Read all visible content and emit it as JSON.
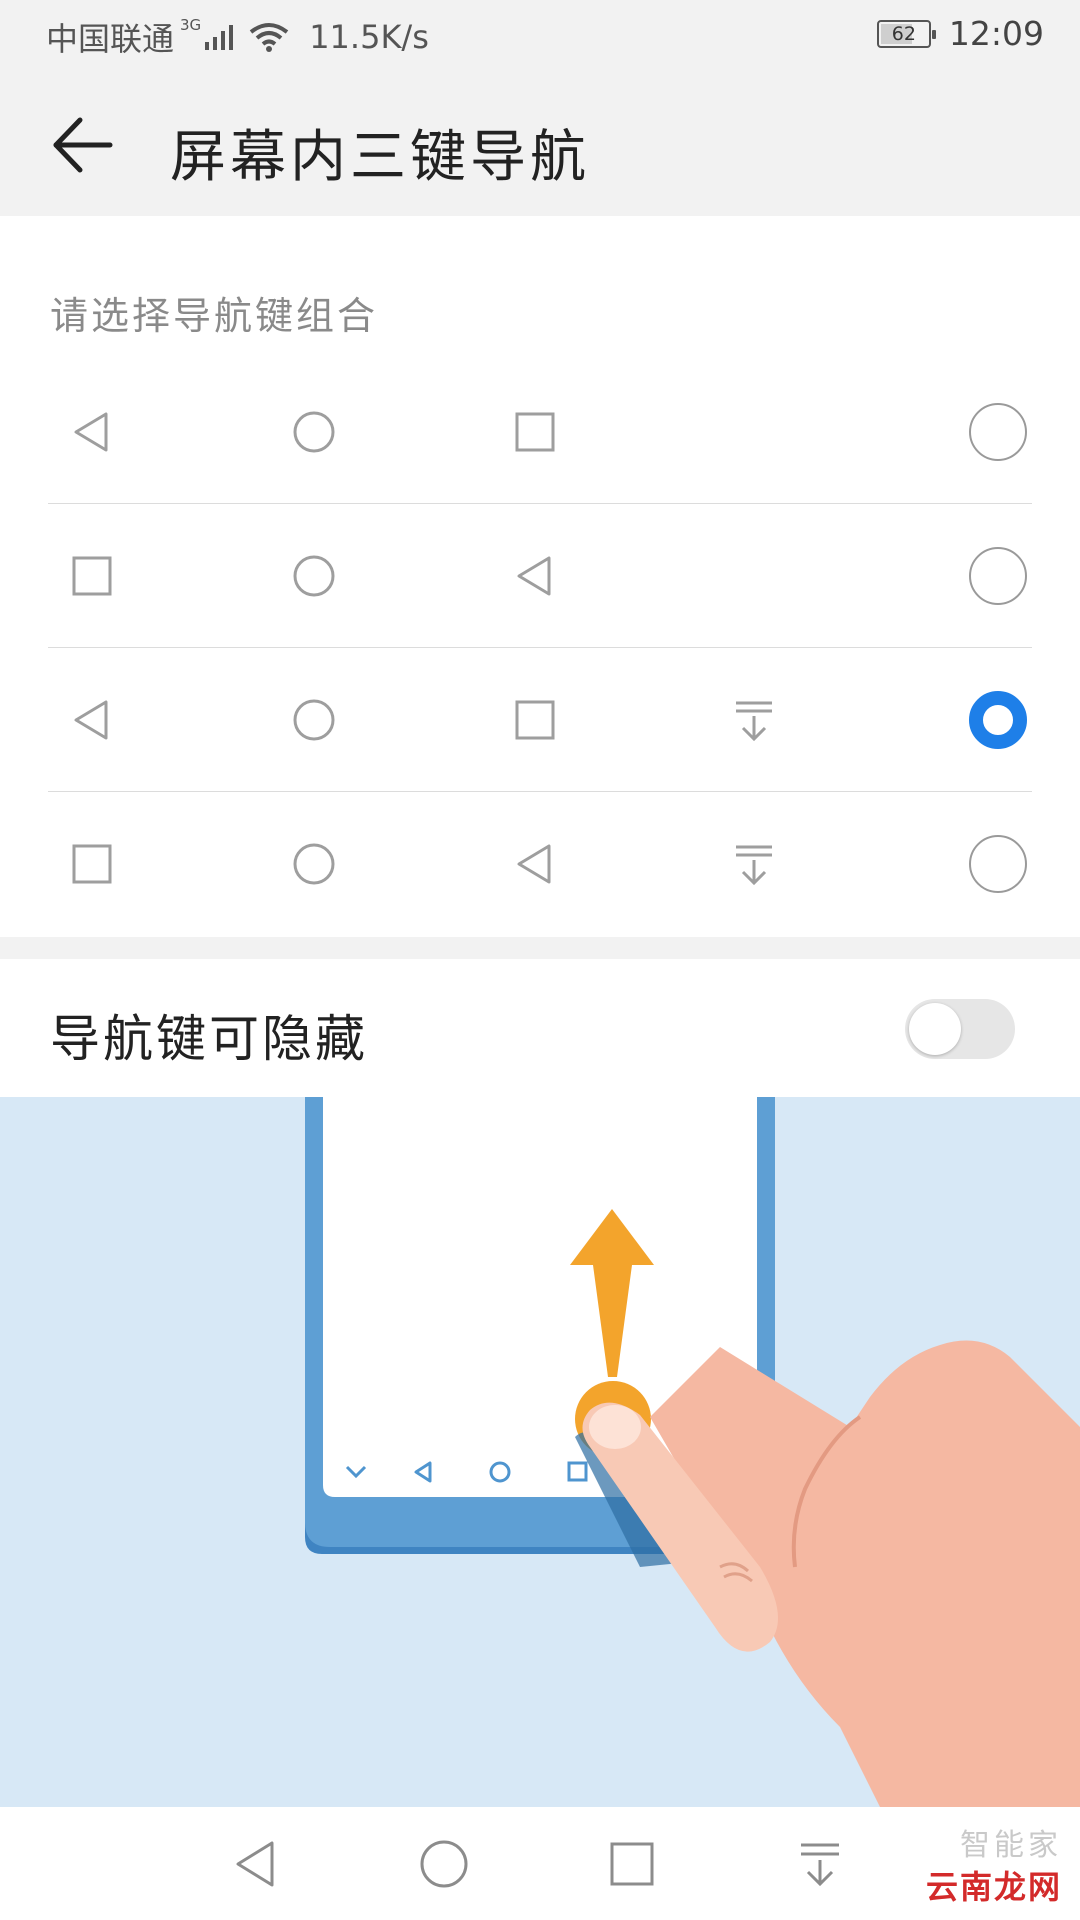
{
  "status_bar": {
    "carrier": "中国联通",
    "network_type": "3G",
    "speed": "11.5K/s",
    "battery_level": "62",
    "time": "12:09",
    "icons": [
      "signal-icon",
      "wifi-icon",
      "battery-icon"
    ]
  },
  "header": {
    "back_icon": "arrow-left-icon",
    "title": "屏幕内三键导航"
  },
  "section": {
    "title": "请选择导航键组合"
  },
  "options": [
    {
      "keys": [
        "back",
        "home",
        "recent"
      ],
      "selected": false
    },
    {
      "keys": [
        "recent",
        "home",
        "back"
      ],
      "selected": false
    },
    {
      "keys": [
        "back",
        "home",
        "recent",
        "notification"
      ],
      "selected": true
    },
    {
      "keys": [
        "recent",
        "home",
        "back",
        "notification"
      ],
      "selected": false
    }
  ],
  "hide_toggle": {
    "label": "导航键可隐藏",
    "enabled": false
  },
  "system_nav": [
    "back-icon",
    "home-icon",
    "recent-apps-icon",
    "notification-pulldown-icon"
  ],
  "watermark": {
    "top": "智能家",
    "bottom": "云南龙网"
  },
  "colors": {
    "accent": "#1e7fe8",
    "background": "#f2f2f2",
    "illustration_bg": "#d7e8f6",
    "phone_frame": "#5e9fd4",
    "arrow": "#f3a42c"
  }
}
